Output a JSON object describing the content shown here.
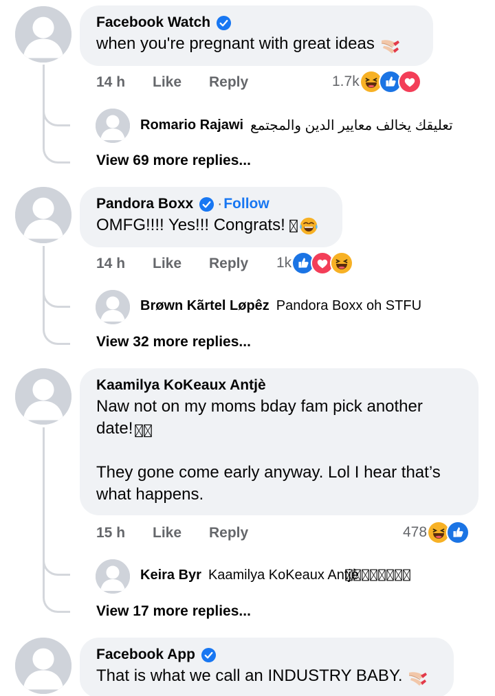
{
  "comments": [
    {
      "author": "Facebook Watch",
      "verified": true,
      "follow": "",
      "text": "when you're pregnant with great ideas",
      "emoji": "nail-polish",
      "time": "14 h",
      "like": "Like",
      "reply": "Reply",
      "reaction_count": "1.7k",
      "reactions": [
        "haha",
        "like",
        "love"
      ],
      "top_reply": {
        "author": "Romario Rajawi",
        "text": "تعليقك يخالف معايير الدين والمجتمع"
      },
      "view_more": "View 69 more replies..."
    },
    {
      "author": "Pandora Boxx",
      "verified": true,
      "follow": "Follow",
      "text": "OMFG!!!! Yes!!! Congrats! ",
      "emoji": "joy",
      "time": "14 h",
      "like": "Like",
      "reply": "Reply",
      "reaction_count": "1k",
      "reactions": [
        "like",
        "love",
        "haha"
      ],
      "top_reply": {
        "author": "Brøwn Kãrtel Løpêz",
        "text": "Pandora Boxx oh STFU"
      },
      "view_more": "View 32 more replies..."
    },
    {
      "author": "Kaamilya KoKeaux Antjè",
      "verified": false,
      "follow": "",
      "text": "Naw not on my moms bday fam pick another\ndate! 󠀠󠀠\n\nThey gone come early anyway. Lol I hear that’s\nwhat happens.",
      "emoji": "",
      "time": "15 h",
      "like": "Like",
      "reply": "Reply",
      "reaction_count": "478",
      "reactions": [
        "haha",
        "like"
      ],
      "top_reply": {
        "author": "Keira Byr",
        "text": "Kaamilya KoKeaux Antjè 󠀠󠀠󠀠󠀠󠀠󠀠󠀠󠀠"
      },
      "view_more": "View 17 more replies..."
    },
    {
      "author": "Facebook App",
      "verified": true,
      "follow": "",
      "text": "That is what we call an INDUSTRY BABY.",
      "emoji": "nail-polish",
      "time": "",
      "like": "",
      "reply": "",
      "reaction_count": "",
      "reactions": [],
      "top_reply": null,
      "view_more": ""
    }
  ],
  "colors": {
    "bubble": "#f0f2f5",
    "verified": "#1877f2",
    "muted": "#65676b",
    "follow": "#1877f2",
    "avatar_bg": "#cfd3da",
    "thread": "#d4d7dc"
  },
  "icons": {
    "verified": "verified-badge-icon",
    "avatar": "default-avatar-icon",
    "like": "like-reaction-icon",
    "love": "love-reaction-icon",
    "haha": "haha-reaction-icon",
    "nail_polish": "nail-polish-emoji-icon"
  }
}
